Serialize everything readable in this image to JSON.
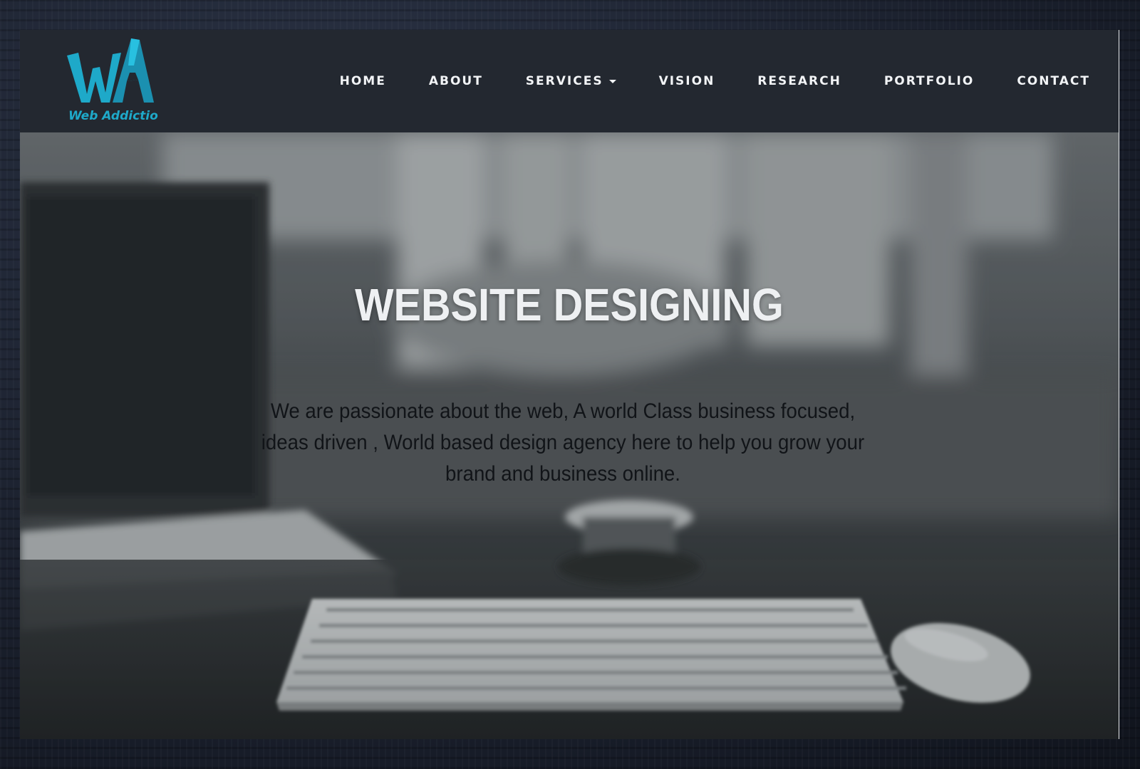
{
  "header": {
    "logo_text": "Web Addiction",
    "logo_letters": "WA",
    "nav": [
      {
        "label": "HOME"
      },
      {
        "label": "ABOUT"
      },
      {
        "label": "SERVICES",
        "dropdown": true
      },
      {
        "label": "VISION"
      },
      {
        "label": "RESEARCH"
      },
      {
        "label": "PORTFOLIO"
      },
      {
        "label": "CONTACT"
      }
    ]
  },
  "hero": {
    "title": "WEBSITE DESIGNING",
    "description": "We are passionate about the web, A world Class business focused, ideas driven , World based design agency here to help you grow your brand and business online."
  },
  "colors": {
    "header_bg": "#232830",
    "logo_accent": "#1ea9c9",
    "nav_text": "#f2f4f6"
  },
  "icons": {
    "dropdown": "chevron-down-icon"
  }
}
